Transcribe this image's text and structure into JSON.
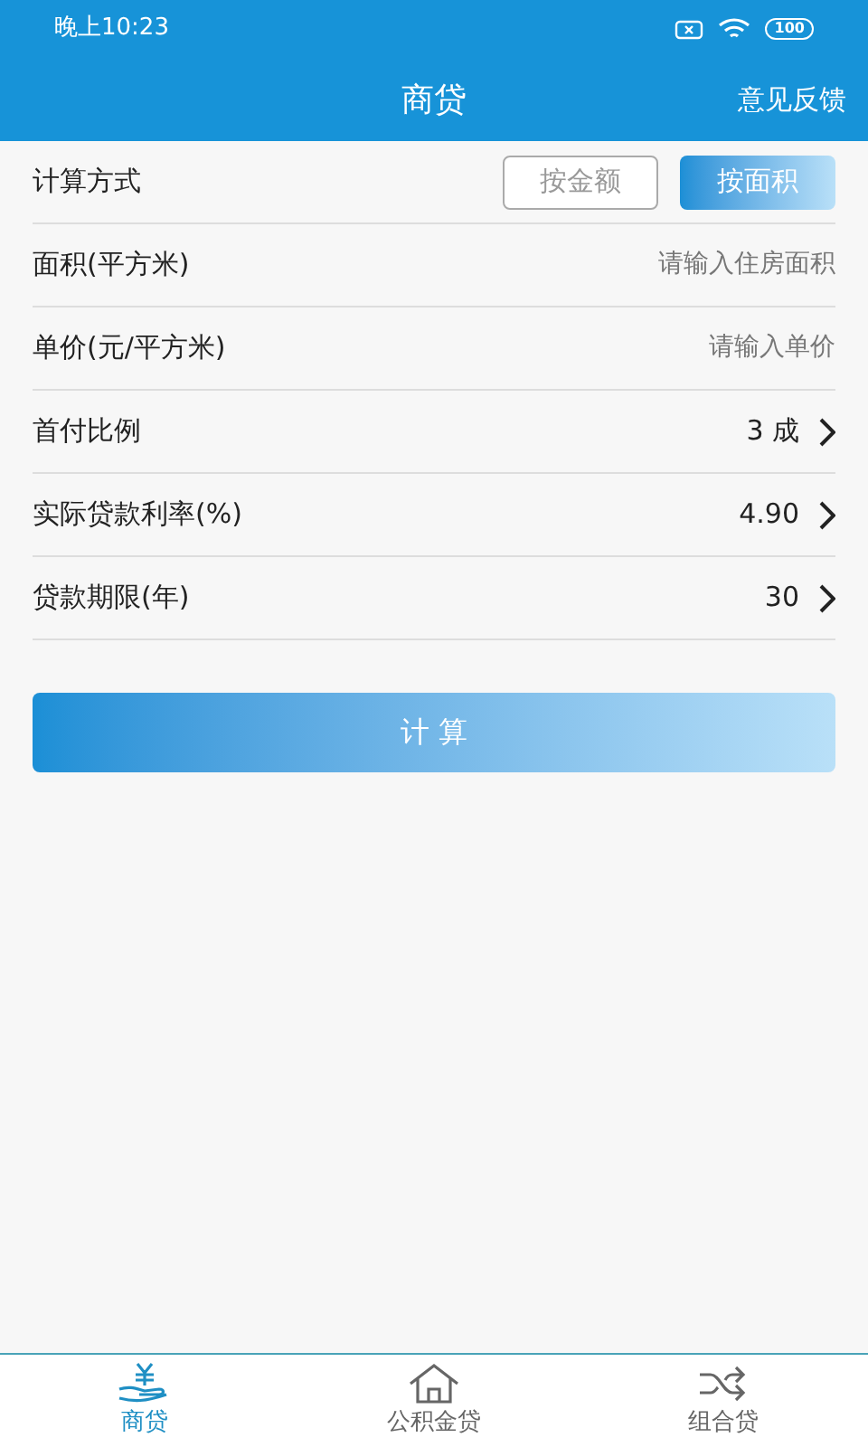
{
  "status_bar": {
    "time": "晚上10:23",
    "battery": "100"
  },
  "header": {
    "title": "商贷",
    "action": "意见反馈"
  },
  "method": {
    "label": "计算方式",
    "options": [
      {
        "label": "按金额",
        "selected": false
      },
      {
        "label": "按面积",
        "selected": true
      }
    ]
  },
  "rows": [
    {
      "kind": "input",
      "label": "面积(平方米)",
      "placeholder": "请输入住房面积"
    },
    {
      "kind": "input",
      "label": "单价(元/平方米)",
      "placeholder": "请输入单价"
    },
    {
      "kind": "select",
      "label": "首付比例",
      "value": "3 成"
    },
    {
      "kind": "select",
      "label": "实际贷款利率(%)",
      "value": "4.90"
    },
    {
      "kind": "select",
      "label": "贷款期限(年)",
      "value": "30"
    }
  ],
  "calculate_button": "计 算",
  "tabs": [
    {
      "label": "商贷",
      "selected": true
    },
    {
      "label": "公积金贷",
      "selected": false
    },
    {
      "label": "组合贷",
      "selected": false
    }
  ]
}
